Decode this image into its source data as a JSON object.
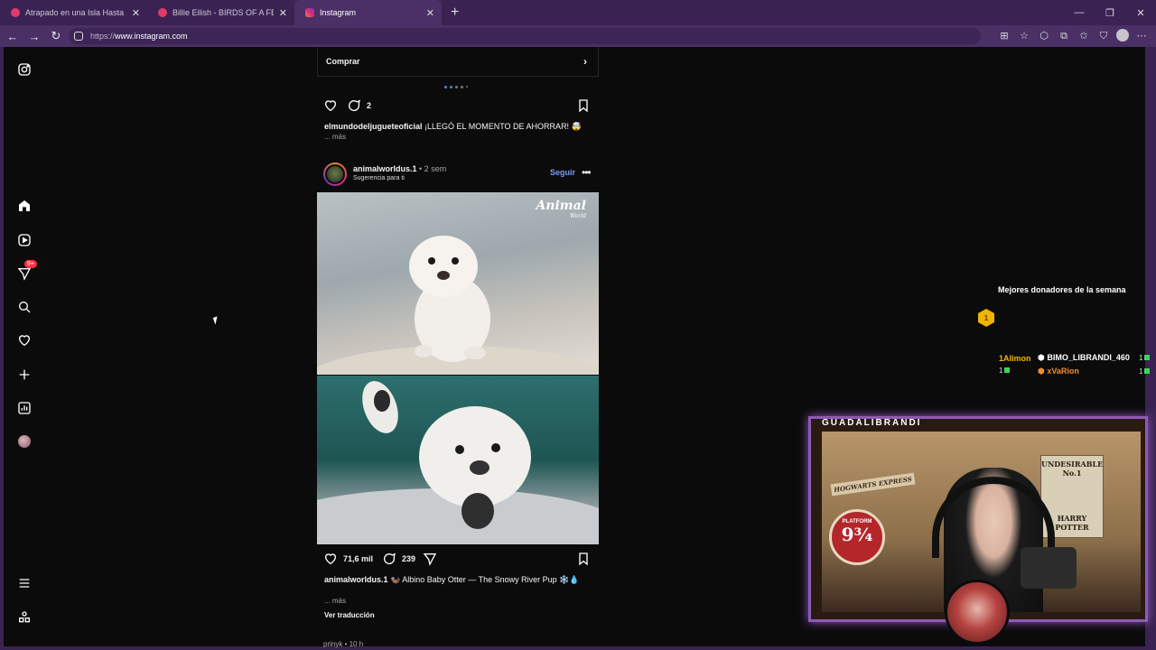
{
  "browser": {
    "tabs": [
      {
        "title": "Atrapado en una Isla Hasta que Ca",
        "active": false,
        "icon_color": "#e03a6a"
      },
      {
        "title": "Billie Eilish - BIRDS OF A FEATHER",
        "active": false,
        "icon_color": "#e03a6a"
      },
      {
        "title": "Instagram",
        "active": true,
        "icon_color": "#dd2a7b"
      }
    ],
    "url_proto": "https://",
    "url_host": "www.instagram.com"
  },
  "sidebar": {
    "notifications_badge": "9+",
    "icons": [
      "instagram-logo-icon",
      "home-icon",
      "reels-icon",
      "messages-icon",
      "search-icon",
      "heart-icon",
      "create-icon",
      "insights-icon",
      "profile-avatar",
      "menu-icon",
      "apps-icon"
    ]
  },
  "feed": {
    "prev_post": {
      "shop_label": "Comprar",
      "comments": "2",
      "caption_user": "elmundodeljugueteoficial",
      "caption_text": "¡LLEGÓ EL MOMENTO DE AHORRAR! 🤯",
      "more": "... más"
    },
    "post": {
      "username": "animalworldus.1",
      "time": " • 2 sem",
      "subtitle": "Sugerencia para ti",
      "follow": "Seguir",
      "brand": "Animal",
      "brand_sub": "World",
      "likes": "71,6 mil",
      "comments": "239",
      "caption_user": "animalworldus.1",
      "caption_text": "🦦 Albino Baby Otter — The Snowy River Pup ❄️💧",
      "more": "... más",
      "translate": "Ver traducción"
    },
    "next_post_user": "prinyk • 10 h"
  },
  "donors": {
    "title": "Mejores donadores de la semana",
    "first": {
      "rank": "1",
      "name": "1Alimon",
      "value": "1"
    },
    "second": {
      "name": "BIMO_LIBRANDI_460",
      "value": "1"
    },
    "third": {
      "name": "xVaRion",
      "value": "1"
    },
    "colors": {
      "gold": "#f0b400",
      "bronze": "#f08c2a",
      "gem": "#3cd65a"
    }
  },
  "stream": {
    "channel": "GUADALIBRANDI",
    "scene_hogwarts": "HOGWARTS EXPRESS",
    "scene_platform_top": "PLATFORM",
    "scene_platform_num": "9¾",
    "poster_text": "UNDESIRABLE No.1",
    "poster_name": "HARRY POTTER"
  }
}
